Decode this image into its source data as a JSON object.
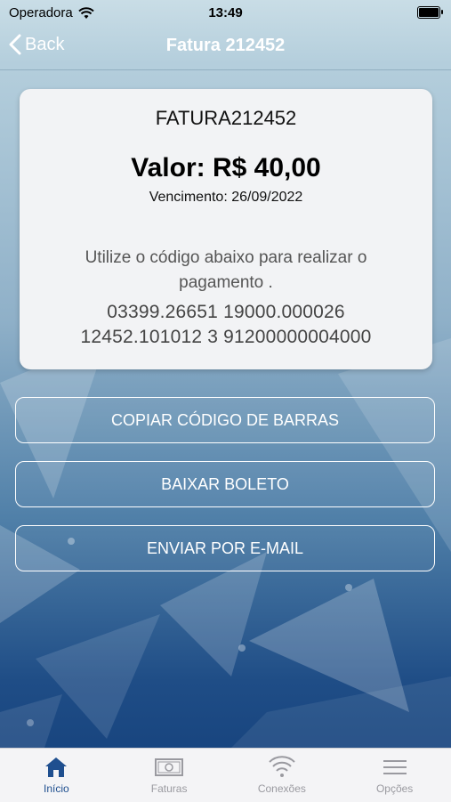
{
  "status_bar": {
    "carrier": "Operadora",
    "time": "13:49"
  },
  "nav": {
    "back_label": "Back",
    "title": "Fatura 212452"
  },
  "invoice": {
    "id_text": "FATURA212452",
    "amount_text": "Valor: R$ 40,00",
    "due_text": "Vencimento: 26/09/2022",
    "instruction": "Utilize o código abaixo para realizar o pagamento .",
    "barcode_line1": "03399.26651 19000.000026",
    "barcode_line2": "12452.101012 3 91200000004000"
  },
  "actions": {
    "copy_label": "COPIAR CÓDIGO DE BARRAS",
    "download_label": "BAIXAR BOLETO",
    "email_label": "ENVIAR POR E-MAIL"
  },
  "tabs": [
    {
      "label": "Início",
      "icon": "home-icon",
      "active": true
    },
    {
      "label": "Faturas",
      "icon": "banknote-icon",
      "active": false
    },
    {
      "label": "Conexões",
      "icon": "wifi-icon",
      "active": false
    },
    {
      "label": "Opções",
      "icon": "menu-icon",
      "active": false
    }
  ],
  "colors": {
    "accent": "#1f4f8f",
    "inactive": "#9a9aa0"
  }
}
